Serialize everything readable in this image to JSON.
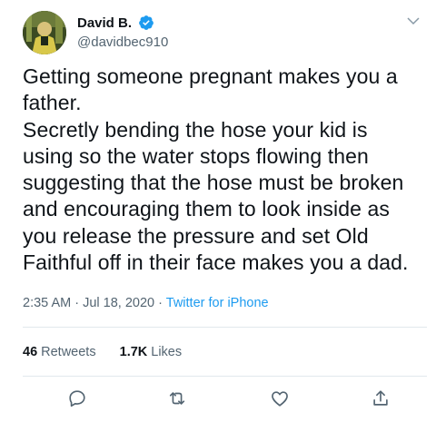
{
  "user": {
    "display_name": "David B.",
    "handle": "@davidbec910",
    "verified": true
  },
  "tweet": {
    "text": "Getting someone pregnant makes you a\nfather.\nSecretly bending the hose your kid is\nusing so the water stops flowing then\nsuggesting that the hose must be broken\nand encouraging them to look inside as\nyou release the pressure and set Old\nFaithful off in their face makes you a dad."
  },
  "meta": {
    "time": "2:35 AM",
    "date": "Jul 18, 2020",
    "separator": "·",
    "source": "Twitter for iPhone"
  },
  "stats": {
    "retweets_count": "46",
    "retweets_label": "Retweets",
    "likes_count": "1.7K",
    "likes_label": "Likes"
  },
  "icons": {
    "verified": "verified-badge-icon",
    "menu": "chevron-down-icon",
    "reply": "reply-icon",
    "retweet": "retweet-icon",
    "like": "heart-icon",
    "share": "share-icon"
  },
  "colors": {
    "accent": "#1d9bf0",
    "text": "#0f1419",
    "secondary": "#536471"
  }
}
